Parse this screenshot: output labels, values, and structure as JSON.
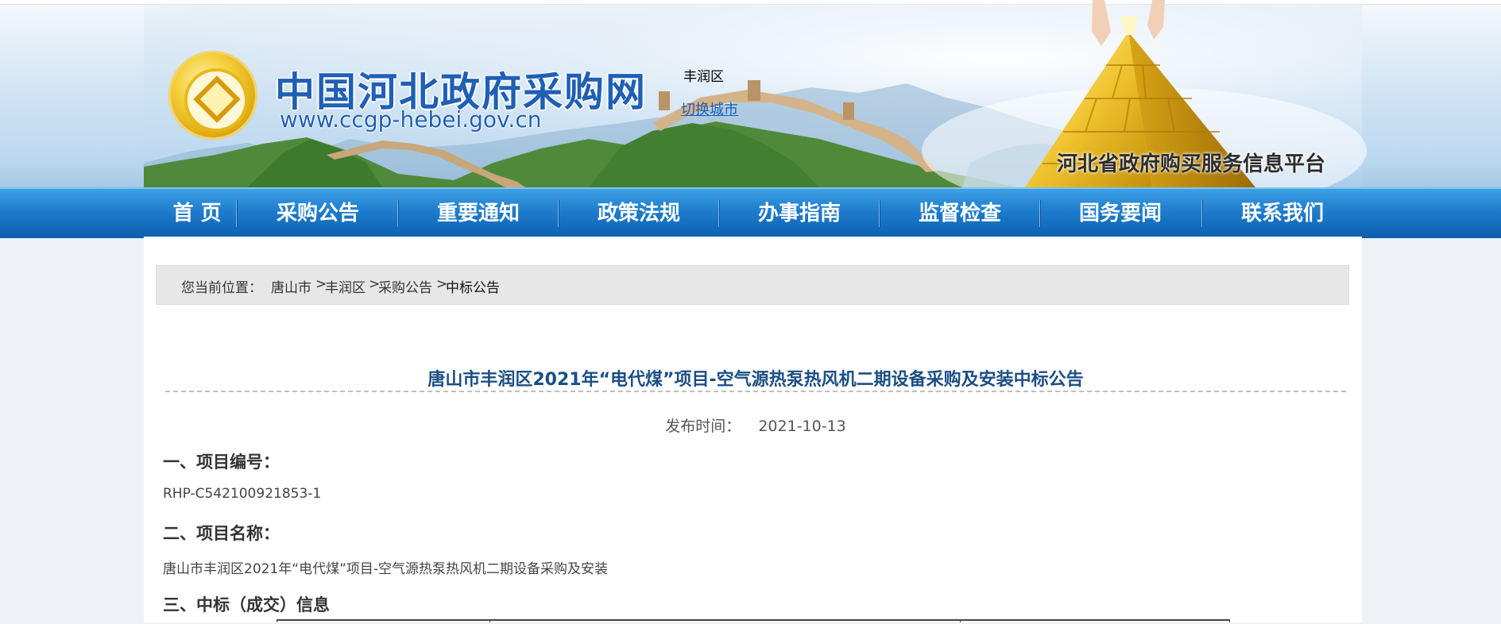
{
  "header": {
    "site_title": "中国河北政府采购网",
    "site_url": "www.ccgp-hebei.gov.cn",
    "district": "丰润区",
    "switch_city": "切换城市",
    "platform_name": "河北省政府购买服务信息平台"
  },
  "nav": {
    "items": [
      "首 页",
      "采购公告",
      "重要通知",
      "政策法规",
      "办事指南",
      "监督检查",
      "国务要闻",
      "联系我们"
    ]
  },
  "breadcrumb": {
    "label": "您当前位置：",
    "items": [
      "唐山市",
      "丰润区",
      "采购公告",
      "中标公告"
    ],
    "separator": ">"
  },
  "article": {
    "title": "唐山市丰润区2021年“电代煤”项目-空气源热泵热风机二期设备采购及安装中标公告",
    "publish_label": "发布时间：",
    "publish_date": "2021-10-13",
    "sections": [
      {
        "heading": "一、项目编号：",
        "text": "RHP-C542100921853-1"
      },
      {
        "heading": "二、项目名称：",
        "text": "唐山市丰润区2021年“电代煤”项目-空气源热泵热风机二期设备采购及安装"
      },
      {
        "heading": "三、中标（成交）信息",
        "text": ""
      }
    ]
  },
  "colors": {
    "nav_bg": "#1e7ccd",
    "title_blue": "#1b4f85",
    "link_blue": "#1a5fb4",
    "page_bg": "#eef1f5"
  }
}
